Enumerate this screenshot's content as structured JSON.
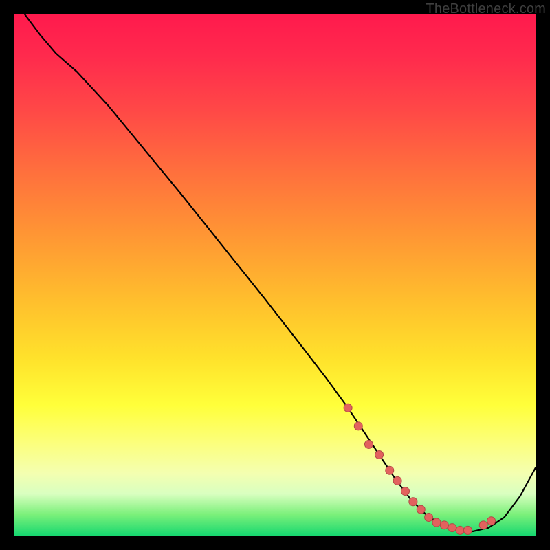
{
  "attribution": "TheBottleneck.com",
  "colors": {
    "attribution": "#3f3f3f",
    "frame": "#000000",
    "curve": "#000000",
    "dot_fill": "#e2625e",
    "dot_stroke": "#b14a46"
  },
  "chart_data": {
    "type": "line",
    "title": "",
    "xlabel": "",
    "ylabel": "",
    "xlim": [
      0,
      100
    ],
    "ylim": [
      0,
      100
    ],
    "grid": false,
    "legend": false,
    "series": [
      {
        "name": "curve",
        "x": [
          2,
          5,
          8,
          12,
          18,
          25,
          32,
          40,
          48,
          55,
          60,
          64,
          67,
          70,
          73,
          76,
          79,
          82,
          85,
          88,
          91,
          94,
          97,
          100
        ],
        "y": [
          100,
          96,
          92.5,
          89,
          82.5,
          74,
          65.5,
          55.5,
          45.5,
          36.5,
          30,
          24.5,
          20,
          15.5,
          11,
          7,
          4,
          2,
          1,
          0.8,
          1.5,
          3.5,
          7.5,
          13
        ]
      }
    ],
    "highlight_dots": {
      "name": "dots",
      "x": [
        64,
        66,
        68,
        70,
        72,
        73.5,
        75,
        76.5,
        78,
        79.5,
        81,
        82.5,
        84,
        85.5,
        87,
        90,
        91.5
      ],
      "y": [
        24.5,
        21,
        17.5,
        15.5,
        12.5,
        10.5,
        8.5,
        6.5,
        5,
        3.5,
        2.5,
        2,
        1.5,
        1,
        1,
        2,
        2.8
      ]
    }
  }
}
